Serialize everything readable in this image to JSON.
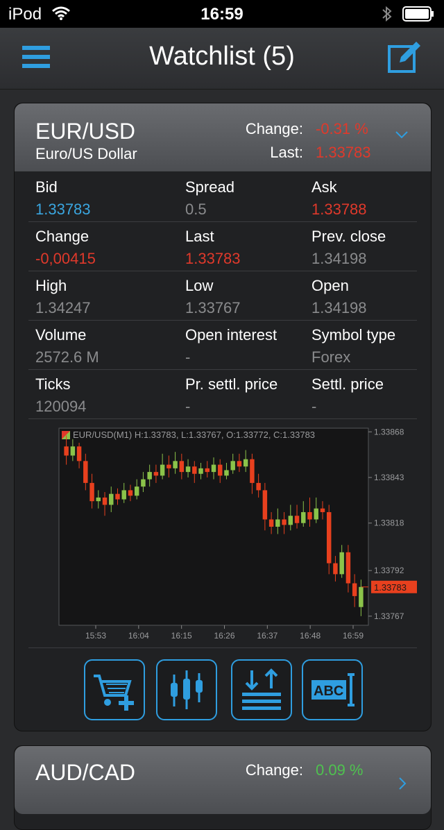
{
  "status": {
    "carrier": "iPod",
    "time": "16:59"
  },
  "nav": {
    "title": "Watchlist (5)"
  },
  "card1": {
    "symbol": "EUR/USD",
    "name": "Euro/US Dollar",
    "change_label": "Change:",
    "change_value": "-0.31 %",
    "last_label": "Last:",
    "last_value": "1.33783",
    "rows": [
      [
        {
          "k": "Bid",
          "v": "1.33783"
        },
        {
          "k": "Spread",
          "v": "0.5"
        },
        {
          "k": "Ask",
          "v": "1.33788"
        }
      ],
      [
        {
          "k": "Change",
          "v": "-0,00415"
        },
        {
          "k": "Last",
          "v": "1.33783"
        },
        {
          "k": "Prev. close",
          "v": "1.34198"
        }
      ],
      [
        {
          "k": "High",
          "v": "1.34247"
        },
        {
          "k": "Low",
          "v": "1.33767"
        },
        {
          "k": "Open",
          "v": "1.34198"
        }
      ],
      [
        {
          "k": "Volume",
          "v": "2572.6 M"
        },
        {
          "k": "Open interest",
          "v": "-"
        },
        {
          "k": "Symbol type",
          "v": "Forex"
        }
      ],
      [
        {
          "k": "Ticks",
          "v": "120094"
        },
        {
          "k": "Pr. settl. price",
          "v": "-"
        },
        {
          "k": "Settl. price",
          "v": "-"
        }
      ]
    ]
  },
  "card2": {
    "symbol": "AUD/CAD",
    "change_label": "Change:",
    "change_value": "0.09 %"
  },
  "colors": {
    "accent": "#2f9ee0",
    "down": "#e0392b",
    "up": "#4fc24f",
    "bid": "#3aa6e0"
  },
  "icons": [
    "menu-icon",
    "edit-icon",
    "chevron-down-icon",
    "cart-plus-icon",
    "candlestick-icon",
    "sort-arrows-icon",
    "abc-text-icon",
    "chevron-right-icon"
  ],
  "chart_data": {
    "type": "candlestick",
    "title": "EUR/USD(M1) H:1.33783, L:1.33767, O:1.33772, C:1.33783",
    "x_ticks": [
      "15:53",
      "16:04",
      "16:15",
      "16:26",
      "16:37",
      "16:48",
      "16:59"
    ],
    "y_ticks": [
      "1.33868",
      "1.33843",
      "1.33818",
      "1.33792",
      "1.33767"
    ],
    "last_price": "1.33783",
    "ylim": [
      1.33762,
      1.3387
    ],
    "candles": [
      {
        "o": 1.3386,
        "c": 1.33855,
        "h": 1.33866,
        "l": 1.3385
      },
      {
        "o": 1.33855,
        "c": 1.3386,
        "h": 1.33864,
        "l": 1.33852
      },
      {
        "o": 1.3386,
        "c": 1.33852,
        "h": 1.33862,
        "l": 1.33848
      },
      {
        "o": 1.33852,
        "c": 1.3384,
        "h": 1.33856,
        "l": 1.33836
      },
      {
        "o": 1.3384,
        "c": 1.3383,
        "h": 1.33845,
        "l": 1.33826
      },
      {
        "o": 1.3383,
        "c": 1.33832,
        "h": 1.33836,
        "l": 1.33826
      },
      {
        "o": 1.33832,
        "c": 1.33828,
        "h": 1.33835,
        "l": 1.33822
      },
      {
        "o": 1.33828,
        "c": 1.33834,
        "h": 1.33838,
        "l": 1.33824
      },
      {
        "o": 1.33834,
        "c": 1.33831,
        "h": 1.33837,
        "l": 1.33828
      },
      {
        "o": 1.33831,
        "c": 1.33836,
        "h": 1.3384,
        "l": 1.33829
      },
      {
        "o": 1.33836,
        "c": 1.33833,
        "h": 1.33839,
        "l": 1.3383
      },
      {
        "o": 1.33833,
        "c": 1.33838,
        "h": 1.33842,
        "l": 1.33831
      },
      {
        "o": 1.33838,
        "c": 1.33842,
        "h": 1.33846,
        "l": 1.33835
      },
      {
        "o": 1.33842,
        "c": 1.33846,
        "h": 1.3385,
        "l": 1.33838
      },
      {
        "o": 1.33846,
        "c": 1.33844,
        "h": 1.3385,
        "l": 1.3384
      },
      {
        "o": 1.33844,
        "c": 1.3385,
        "h": 1.33856,
        "l": 1.33842
      },
      {
        "o": 1.3385,
        "c": 1.33848,
        "h": 1.33855,
        "l": 1.33843
      },
      {
        "o": 1.33848,
        "c": 1.33852,
        "h": 1.33857,
        "l": 1.33845
      },
      {
        "o": 1.33852,
        "c": 1.33846,
        "h": 1.33856,
        "l": 1.33842
      },
      {
        "o": 1.33846,
        "c": 1.33849,
        "h": 1.33853,
        "l": 1.33843
      },
      {
        "o": 1.33849,
        "c": 1.33845,
        "h": 1.33852,
        "l": 1.3384
      },
      {
        "o": 1.33845,
        "c": 1.33848,
        "h": 1.33851,
        "l": 1.33842
      },
      {
        "o": 1.33848,
        "c": 1.33846,
        "h": 1.33852,
        "l": 1.33843
      },
      {
        "o": 1.33846,
        "c": 1.3385,
        "h": 1.33854,
        "l": 1.33842
      },
      {
        "o": 1.3385,
        "c": 1.33844,
        "h": 1.33853,
        "l": 1.3384
      },
      {
        "o": 1.33844,
        "c": 1.33847,
        "h": 1.33851,
        "l": 1.33842
      },
      {
        "o": 1.33847,
        "c": 1.33852,
        "h": 1.33856,
        "l": 1.33845
      },
      {
        "o": 1.33852,
        "c": 1.33849,
        "h": 1.33856,
        "l": 1.33846
      },
      {
        "o": 1.33849,
        "c": 1.33853,
        "h": 1.33858,
        "l": 1.33846
      },
      {
        "o": 1.33853,
        "c": 1.3384,
        "h": 1.33856,
        "l": 1.33834
      },
      {
        "o": 1.3384,
        "c": 1.33836,
        "h": 1.33845,
        "l": 1.33832
      },
      {
        "o": 1.33836,
        "c": 1.3382,
        "h": 1.3384,
        "l": 1.33814
      },
      {
        "o": 1.3382,
        "c": 1.33816,
        "h": 1.33824,
        "l": 1.33812
      },
      {
        "o": 1.33816,
        "c": 1.3382,
        "h": 1.33826,
        "l": 1.33812
      },
      {
        "o": 1.3382,
        "c": 1.33817,
        "h": 1.33824,
        "l": 1.33812
      },
      {
        "o": 1.33817,
        "c": 1.33822,
        "h": 1.33828,
        "l": 1.33814
      },
      {
        "o": 1.33822,
        "c": 1.33818,
        "h": 1.33828,
        "l": 1.33815
      },
      {
        "o": 1.33818,
        "c": 1.33824,
        "h": 1.3383,
        "l": 1.33816
      },
      {
        "o": 1.33824,
        "c": 1.3382,
        "h": 1.33832,
        "l": 1.33816
      },
      {
        "o": 1.3382,
        "c": 1.33826,
        "h": 1.33832,
        "l": 1.33818
      },
      {
        "o": 1.33826,
        "c": 1.33824,
        "h": 1.3383,
        "l": 1.3382
      },
      {
        "o": 1.33824,
        "c": 1.33796,
        "h": 1.33828,
        "l": 1.3379
      },
      {
        "o": 1.33796,
        "c": 1.3379,
        "h": 1.338,
        "l": 1.33786
      },
      {
        "o": 1.3379,
        "c": 1.33802,
        "h": 1.33806,
        "l": 1.33788
      },
      {
        "o": 1.33802,
        "c": 1.33785,
        "h": 1.33806,
        "l": 1.3378
      },
      {
        "o": 1.33785,
        "c": 1.33778,
        "h": 1.3379,
        "l": 1.33772
      },
      {
        "o": 1.33772,
        "c": 1.33783,
        "h": 1.33787,
        "l": 1.33767
      }
    ]
  }
}
